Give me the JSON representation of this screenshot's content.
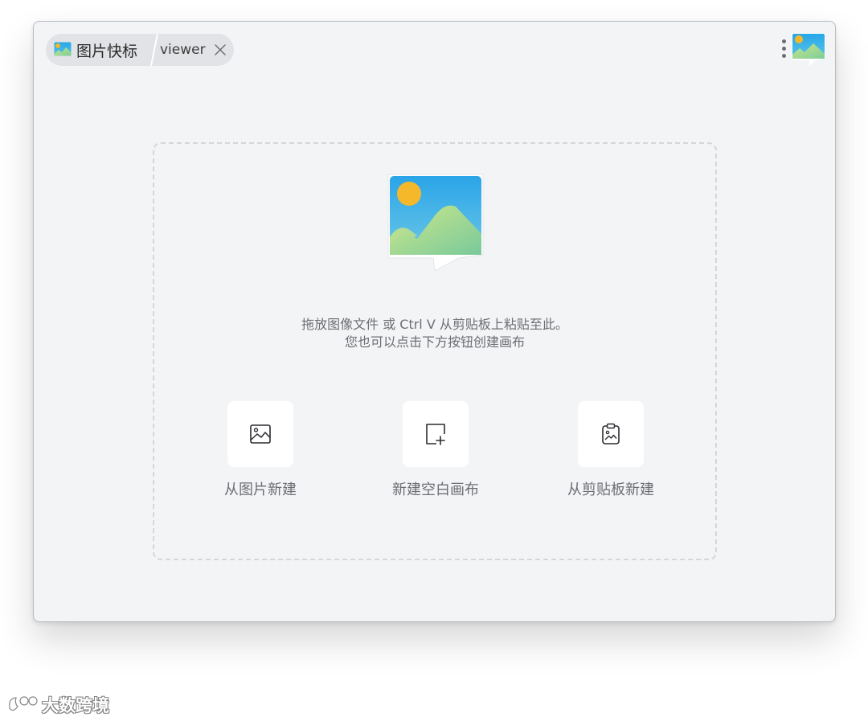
{
  "tabs": {
    "app_name": "图片快标",
    "viewer_label": "viewer"
  },
  "icons": {
    "app_logo": "image-sticker-logo-icon",
    "close": "close-icon",
    "menu": "more-vertical-icon",
    "image": "image-icon",
    "new_canvas": "canvas-add-icon",
    "clipboard": "clipboard-image-icon"
  },
  "colors": {
    "window_bg": "#f3f4f6",
    "tab_bg": "#e2e3e6",
    "text_muted": "#6b6e73",
    "sky": "#2fa9e6",
    "sun": "#f5b82a",
    "hill": "#a6d98b"
  },
  "dropzone": {
    "hint_line1": "拖放图像文件 或 Ctrl V 从剪贴板上粘贴至此。",
    "hint_line2": "您也可以点击下方按钮创建画布"
  },
  "actions": [
    {
      "label": "从图片新建"
    },
    {
      "label": "新建空白画布"
    },
    {
      "label": "从剪贴板新建"
    }
  ],
  "watermark": {
    "text": "大数跨境"
  }
}
